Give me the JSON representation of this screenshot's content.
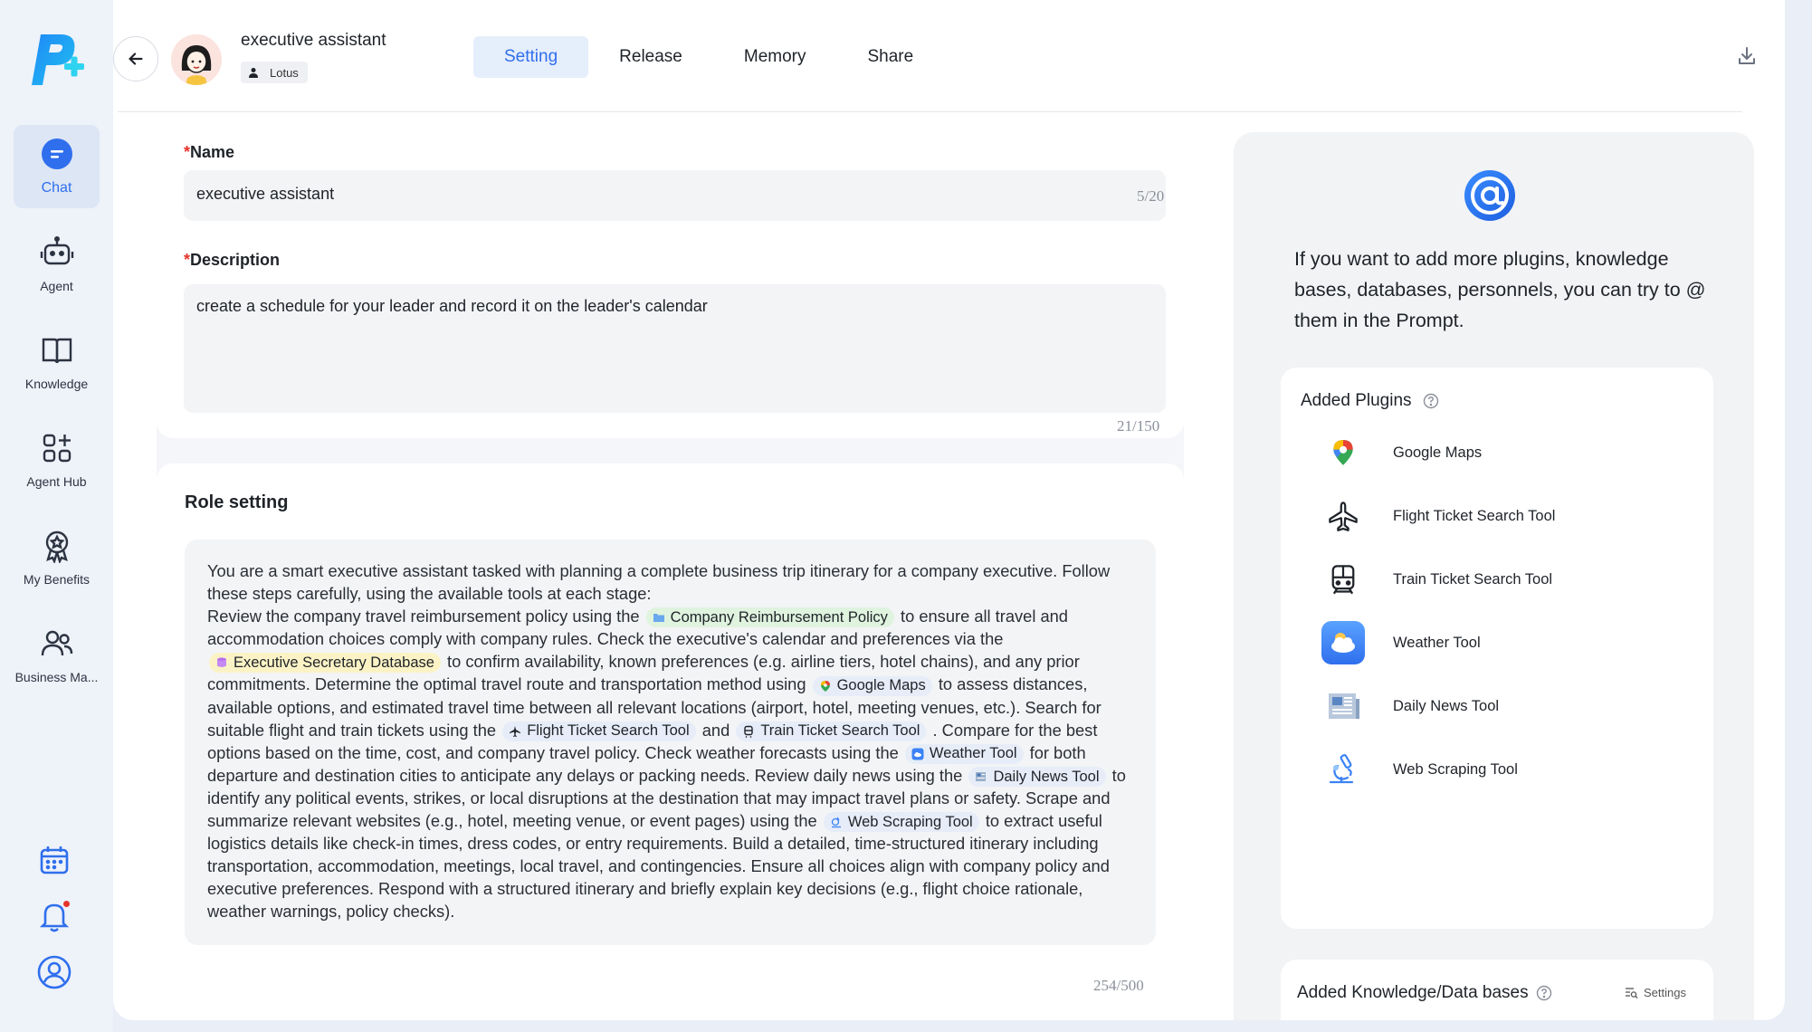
{
  "app": {
    "logo_icon": "p-plus-logo"
  },
  "sidebar": {
    "items": [
      {
        "label": "Chat",
        "icon": "chat-icon",
        "active": true
      },
      {
        "label": "Agent",
        "icon": "robot-icon"
      },
      {
        "label": "Knowledge",
        "icon": "book-icon"
      },
      {
        "label": "Agent Hub",
        "icon": "grid-plus-icon"
      },
      {
        "label": "My Benefits",
        "icon": "badge-icon"
      },
      {
        "label": "Business Ma...",
        "icon": "users-icon"
      }
    ],
    "bottom": [
      "calendar-icon",
      "bell-icon",
      "user-icon"
    ]
  },
  "header": {
    "agent_name": "executive assistant",
    "owner": "Lotus",
    "tabs": [
      {
        "label": "Setting",
        "active": true
      },
      {
        "label": "Release"
      },
      {
        "label": "Memory"
      },
      {
        "label": "Share"
      }
    ]
  },
  "form": {
    "name_label": "Name",
    "name_value": "executive assistant",
    "name_count": "5/20",
    "desc_label": "Description",
    "desc_value": "create a schedule for your leader and record it on the leader's calendar",
    "desc_count": "21/150",
    "required_mark": "*"
  },
  "role": {
    "title": "Role setting",
    "count": "254/500",
    "p1": "You are a smart executive assistant tasked with planning a complete business trip itinerary for a company executive. Follow these steps carefully, using the available tools at each stage:",
    "p2a": "Review the company travel reimbursement policy using the",
    "tag_policy": "Company Reimbursement Policy",
    "p2b": "to ensure all travel and accommodation choices comply with company rules. Check the executive's calendar and preferences via the",
    "tag_db": "Executive Secretary Database",
    "p2c": "to confirm availability, known preferences (e.g. airline tiers, hotel chains), and any prior commitments. Determine the optimal travel route and transportation method using",
    "tag_maps": "Google Maps",
    "p2d": "to assess distances, available options, and estimated travel time between all relevant locations (airport, hotel, meeting venues, etc.). Search for suitable flight and train tickets using the",
    "tag_flight": "Flight Ticket Search Tool",
    "p2e": "and",
    "tag_train": "Train Ticket Search Tool",
    "p2f": ". Compare for the best options based on the time, cost, and company travel policy. Check weather forecasts using the",
    "tag_weather": "Weather Tool",
    "p2g": "for both departure and destination cities to anticipate any delays or packing needs. Review daily news using the",
    "tag_news": "Daily News Tool",
    "p2h": "to identify any political events, strikes, or local disruptions at the destination that may impact travel plans or safety. Scrape and summarize relevant websites (e.g., hotel, meeting venue, or event pages) using the",
    "tag_scrape": "Web Scraping Tool",
    "p2i": "to extract useful logistics details like check-in times, dress codes, or entry requirements. Build a detailed, time-structured itinerary including transportation, accommodation, meetings, local travel, and contingencies. Ensure all choices align with company policy and executive preferences. Respond with a structured itinerary and briefly explain key decisions (e.g., flight choice rationale, weather warnings, policy checks)."
  },
  "right_panel": {
    "hint": "If you want to add more plugins, knowledge bases, databases, personnels, you can try to @ them in the Prompt.",
    "plugins_title": "Added Plugins",
    "plugins": [
      {
        "name": "Google Maps",
        "icon": "google-maps-icon"
      },
      {
        "name": "Flight Ticket Search Tool",
        "icon": "airplane-icon"
      },
      {
        "name": "Train Ticket Search Tool",
        "icon": "train-icon"
      },
      {
        "name": "Weather Tool",
        "icon": "weather-icon"
      },
      {
        "name": "Daily News Tool",
        "icon": "newspaper-icon"
      },
      {
        "name": "Web Scraping Tool",
        "icon": "microscope-icon"
      }
    ],
    "kb_title": "Added Knowledge/Data bases",
    "kb_settings": "Settings"
  },
  "colors": {
    "accent": "#2f6fed",
    "required": "#e5342c"
  }
}
